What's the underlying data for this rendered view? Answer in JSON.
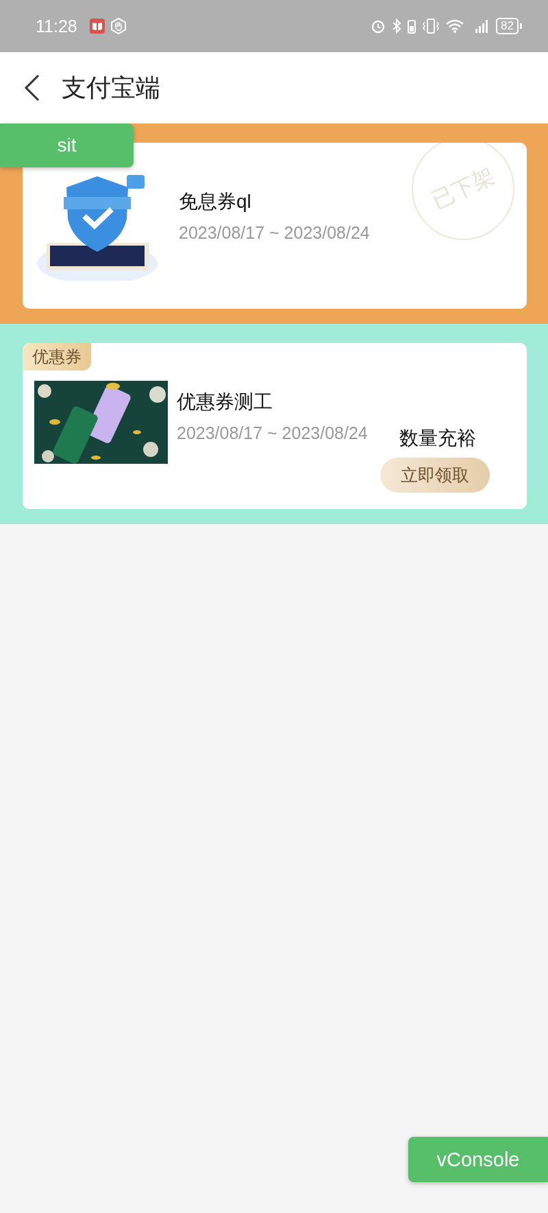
{
  "status_bar": {
    "time": "11:28",
    "battery": "82"
  },
  "header": {
    "title": "支付宝端"
  },
  "env_badge": "sit",
  "coupons": [
    {
      "color": "#eea656",
      "title": "免息券ql",
      "date_range": "2023/08/17 ~ 2023/08/24",
      "stamp": "已下架"
    },
    {
      "color": "#a0ecd8",
      "tag": "优惠券",
      "title": "优惠券测工",
      "date_range": "2023/08/17 ~ 2023/08/24",
      "stock": "数量充裕",
      "action": "立即领取"
    }
  ],
  "vconsole_button": "vConsole"
}
